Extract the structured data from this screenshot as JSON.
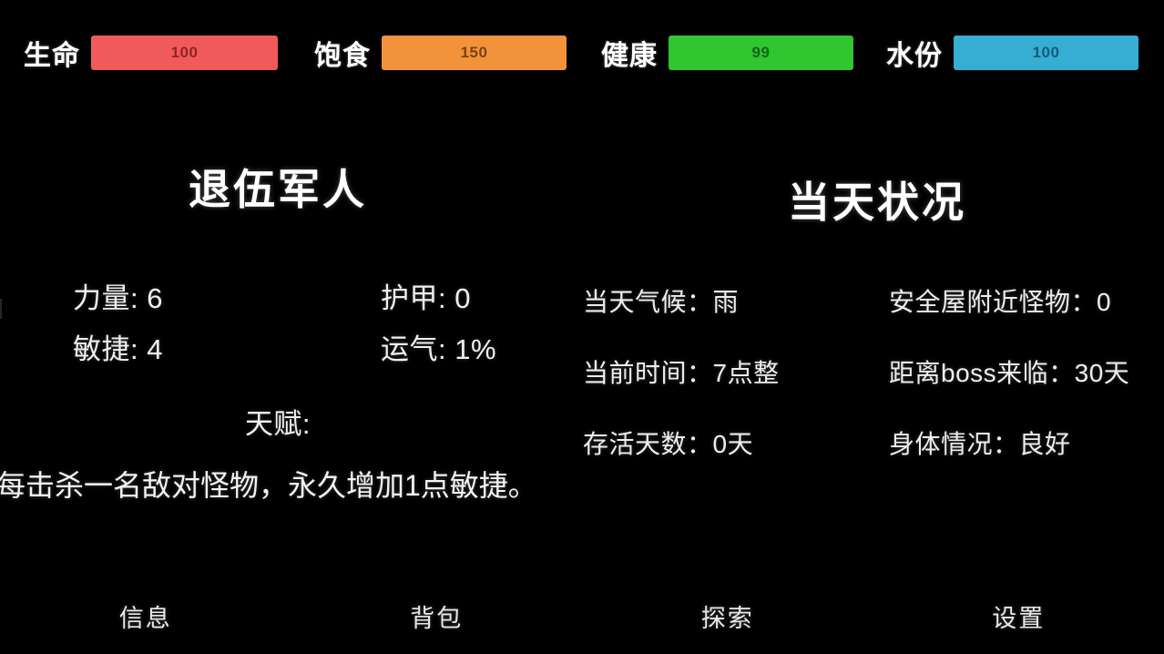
{
  "status_bars": [
    {
      "label": "生命",
      "value": "100",
      "color": "#f05a5a",
      "text_color": "#8e2525",
      "name": "health"
    },
    {
      "label": "饱食",
      "value": "150",
      "color": "#f2933c",
      "text_color": "#7a4410",
      "name": "food"
    },
    {
      "label": "健康",
      "value": "99",
      "color": "#2fc62f",
      "text_color": "#11651a",
      "name": "wellness"
    },
    {
      "label": "水份",
      "value": "100",
      "color": "#36aed4",
      "text_color": "#135b77",
      "name": "water"
    }
  ],
  "character": {
    "title": "退伍军人",
    "strength": "力量: 6",
    "agility": "敏捷: 4",
    "armor": "护甲: 0",
    "luck": "运气: 1%",
    "talent_label": "天赋:",
    "talent_text": "每击杀一名敌对怪物，永久增加1点敏捷。"
  },
  "daily": {
    "title": "当天状况",
    "weather": "当天气候：雨",
    "time": "当前时间：7点整",
    "days_survived": "存活天数：0天",
    "monsters_near_shelter": "安全屋附近怪物：0",
    "boss_countdown": "距离boss来临：30天",
    "body_condition": "身体情况：良好"
  },
  "nav": [
    {
      "label": "信息"
    },
    {
      "label": "背包"
    },
    {
      "label": "探索"
    },
    {
      "label": "设置"
    }
  ]
}
